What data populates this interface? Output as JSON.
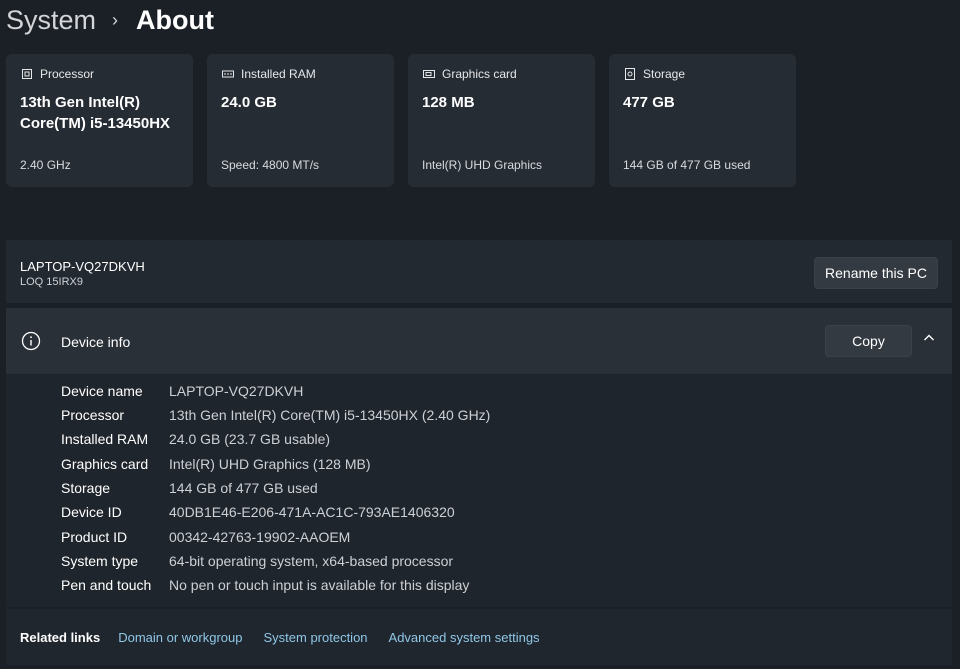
{
  "breadcrumb": {
    "parent": "System",
    "separator": "›",
    "current": "About"
  },
  "specs": [
    {
      "title": "Processor",
      "icon": "processor-icon",
      "value": "13th Gen Intel(R) Core(TM) i5-13450HX",
      "sub": "2.40 GHz"
    },
    {
      "title": "Installed RAM",
      "icon": "ram-icon",
      "value": "24.0 GB",
      "sub": "Speed: 4800 MT/s"
    },
    {
      "title": "Graphics card",
      "icon": "graphics-card-icon",
      "value": "128 MB",
      "sub": "Intel(R) UHD Graphics"
    },
    {
      "title": "Storage",
      "icon": "storage-icon",
      "value": "477 GB",
      "sub": "144 GB of 477 GB used"
    }
  ],
  "pc": {
    "name": "LAPTOP-VQ27DKVH",
    "model": "LOQ 15IRX9",
    "rename_label": "Rename this PC"
  },
  "device_info": {
    "title": "Device info",
    "copy_label": "Copy",
    "rows": [
      {
        "label": "Device name",
        "value": "LAPTOP-VQ27DKVH"
      },
      {
        "label": "Processor",
        "value": "13th Gen Intel(R) Core(TM) i5-13450HX (2.40 GHz)"
      },
      {
        "label": "Installed RAM",
        "value": "24.0 GB (23.7 GB usable)"
      },
      {
        "label": "Graphics card",
        "value": "Intel(R) UHD Graphics (128 MB)"
      },
      {
        "label": "Storage",
        "value": "144 GB of 477 GB used"
      },
      {
        "label": "Device ID",
        "value": "40DB1E46-E206-471A-AC1C-793AE1406320"
      },
      {
        "label": "Product ID",
        "value": "00342-42763-19902-AAOEM"
      },
      {
        "label": "System type",
        "value": "64-bit operating system, x64-based processor"
      },
      {
        "label": "Pen and touch",
        "value": "No pen or touch input is available for this display"
      }
    ]
  },
  "related": {
    "title": "Related links",
    "links": [
      "Domain or workgroup",
      "System protection",
      "Advanced system settings"
    ]
  },
  "colors": {
    "background": "#1b2027",
    "card": "#262c34",
    "link": "#8fc7e8"
  }
}
